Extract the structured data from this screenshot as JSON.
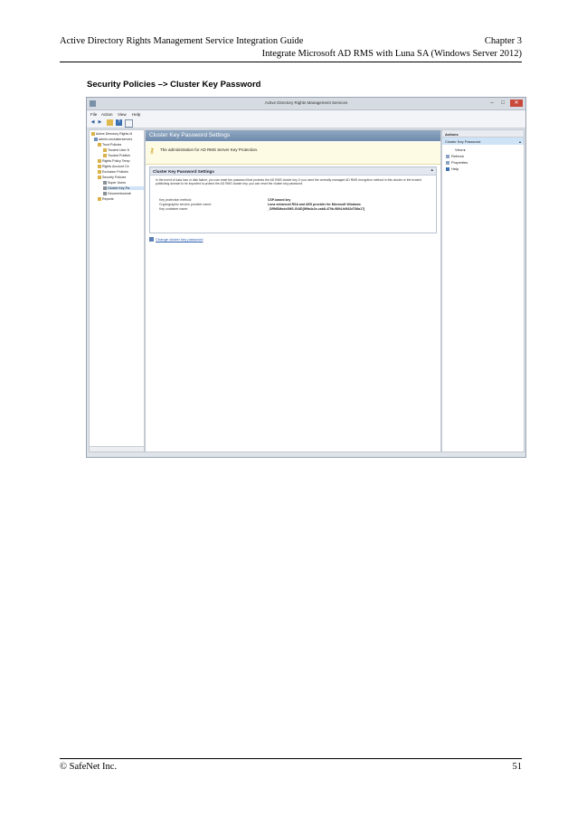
{
  "header": {
    "left": "Active Directory Rights Management Service Integration Guide",
    "right_line1": "Chapter 3",
    "right_line2": "Integrate Microsoft AD RMS with Luna SA (Windows Server 2012)"
  },
  "section_title": "Security Policies –> Cluster Key Password",
  "window": {
    "title": "Active Directory Rights Management Services",
    "controls": {
      "minimize": "–",
      "maximize": "□",
      "close": "✕"
    },
    "menu": [
      "File",
      "Action",
      "View",
      "Help"
    ],
    "toolbar_icons": [
      "back-arrow-icon",
      "forward-arrow-icon",
      "folder-icon",
      "help-icon",
      "panel-icon"
    ],
    "tree": {
      "items": [
        "Active Directory Rights M",
        "admin-onclusterservers",
        "Trust Policies",
        "Trusted User D",
        "Trusted Publish",
        "Rights Policy Temp",
        "Rights Account Ce",
        "Exclusion Policies",
        "Security Policies",
        "Super Users",
        "Cluster Key Pa",
        "Decommissionin",
        "Reports"
      ],
      "selected_index": 10
    },
    "center": {
      "heading": "Cluster Key Password Settings",
      "banner_text": "The administration for AD RMS Server Key Protection.",
      "panel_title": "Cluster Key Password Settings",
      "description": "In the event of data loss or disk failure, you can reset the password that protects the AD RMS cluster key. If you used the centrally managed AD RMS encryption method in this cluster or the trusted publishing domain to be imported to protect the AD RMS cluster key, you can reset the cluster key password.",
      "fields": [
        {
          "label": "Key protection method:",
          "value": "CSP-based key"
        },
        {
          "label": "Cryptographic service provider name:",
          "value": "Luna enhanced RSA and AES provider for Microsoft Windows"
        },
        {
          "label": "Key container name:",
          "value": "_DRMSMode2MS-GUID{8f9a4c2e-cab8-470b-9894-fd542d736a17}"
        }
      ],
      "change_link": "Change cluster key password"
    },
    "actions": {
      "header": "Actions",
      "selected": "Cluster Key Password",
      "items": [
        "View",
        "Refresh",
        "Properties",
        "Help"
      ]
    }
  },
  "footer": {
    "left": "© SafeNet Inc.",
    "page_number": "51"
  }
}
